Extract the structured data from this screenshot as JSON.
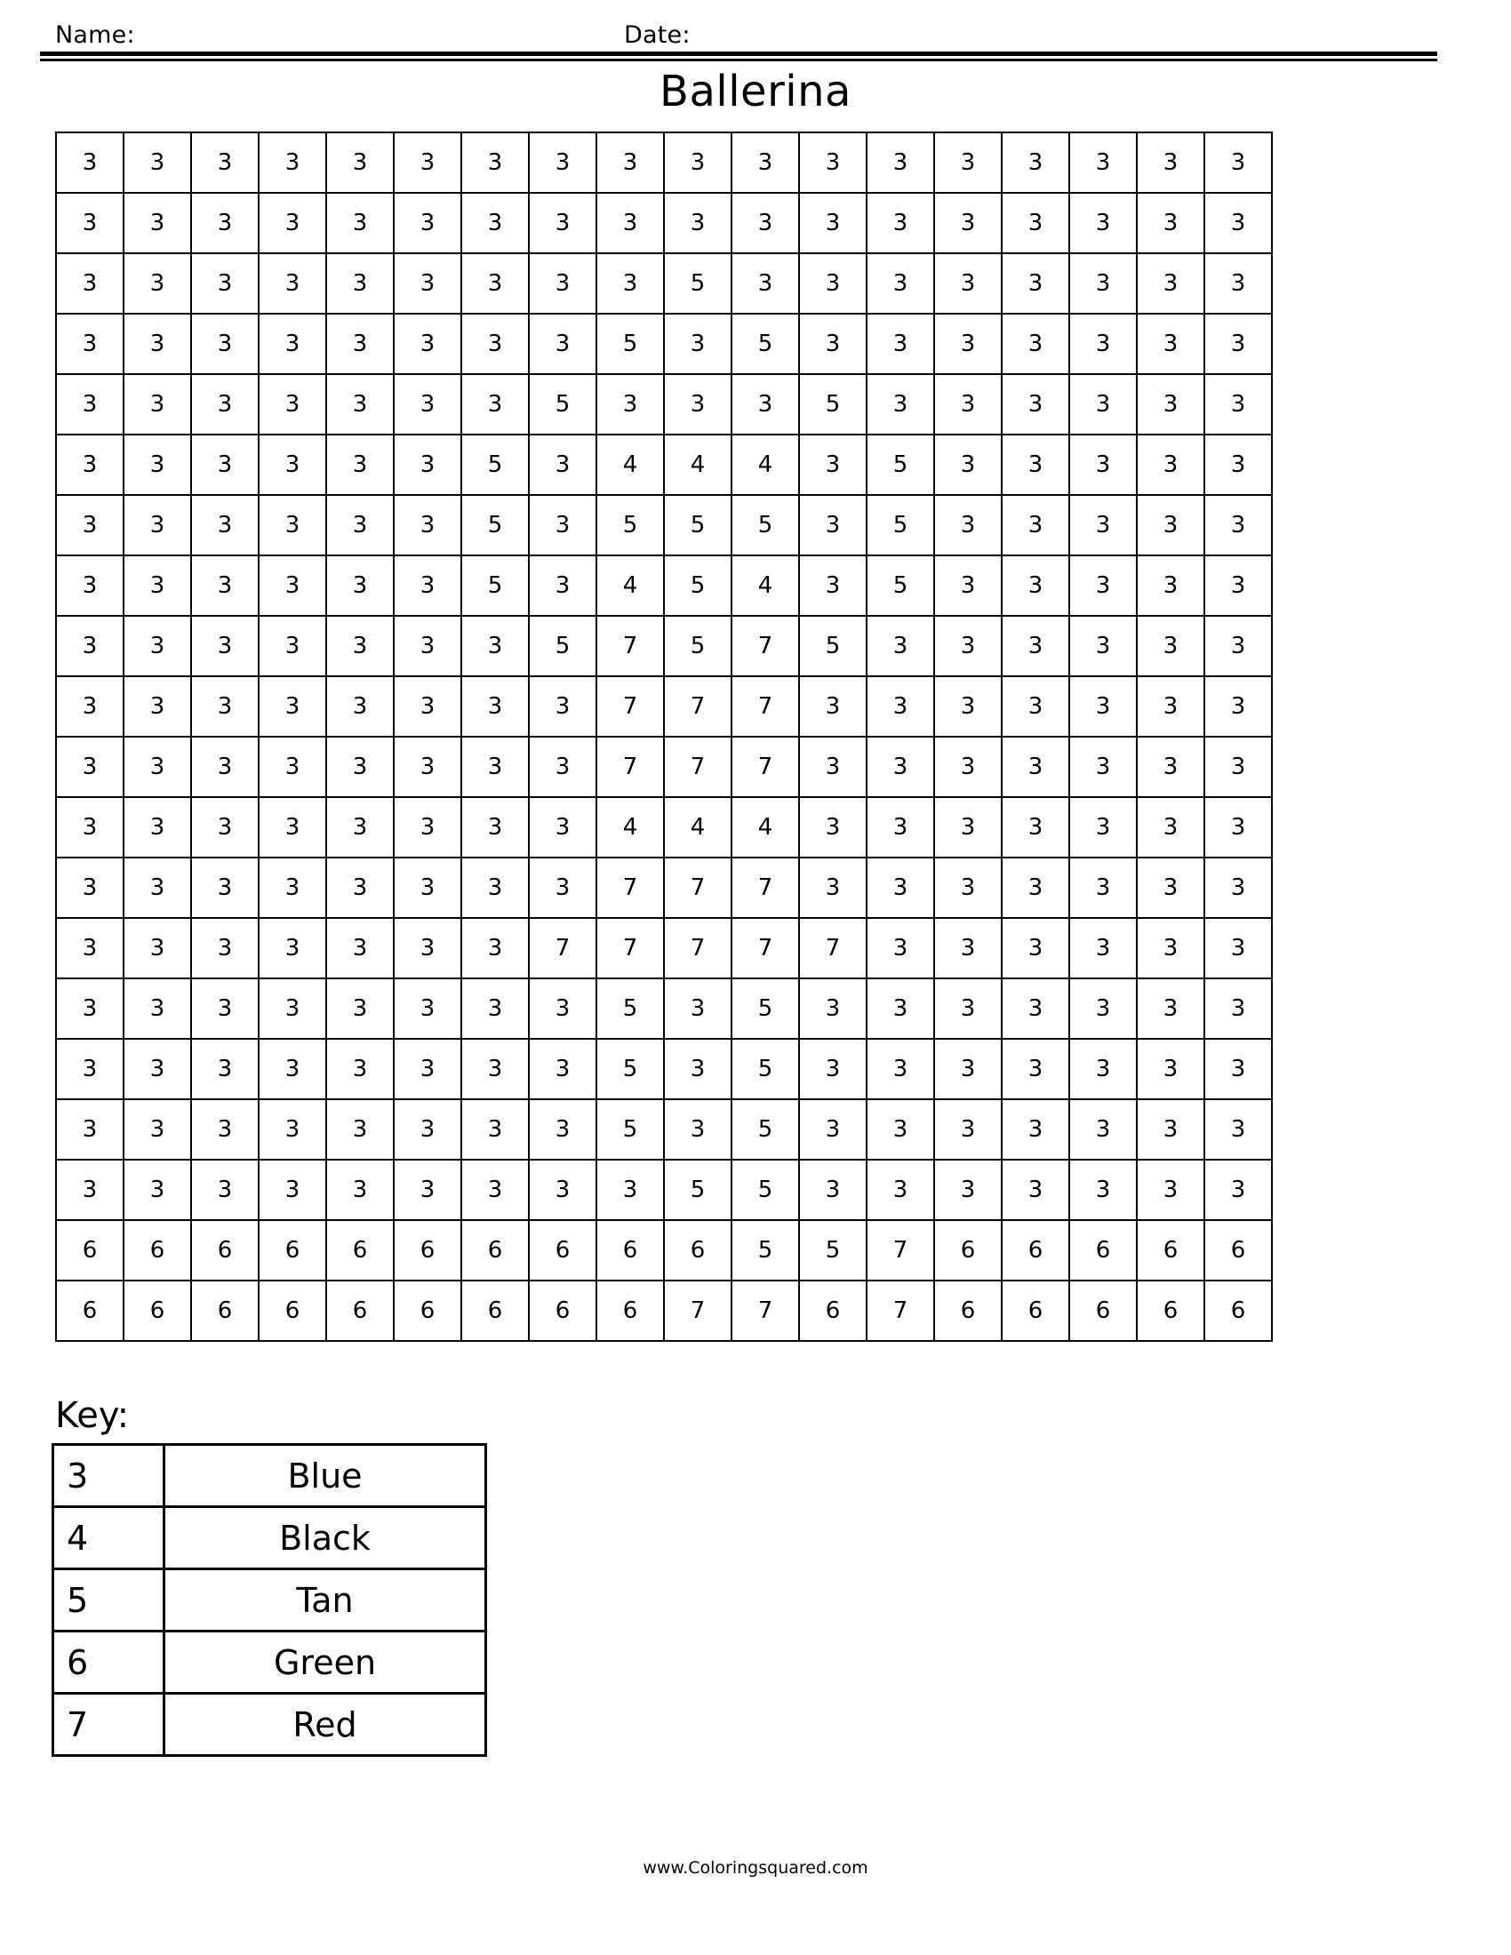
{
  "header": {
    "name_label": "Name:",
    "date_label": "Date:"
  },
  "title": "Ballerina",
  "key": {
    "heading": "Key:",
    "rows": [
      {
        "number": "3",
        "color": "Blue"
      },
      {
        "number": "4",
        "color": "Black"
      },
      {
        "number": "5",
        "color": "Tan"
      },
      {
        "number": "6",
        "color": "Green"
      },
      {
        "number": "7",
        "color": "Red"
      }
    ]
  },
  "footer": "www.Coloringsquared.com",
  "chart_data": {
    "type": "table",
    "title": "Ballerina",
    "rows": 20,
    "columns": 18,
    "legend": [
      {
        "value": "3",
        "label": "Blue"
      },
      {
        "value": "4",
        "label": "Black"
      },
      {
        "value": "5",
        "label": "Tan"
      },
      {
        "value": "6",
        "label": "Green"
      },
      {
        "value": "7",
        "label": "Red"
      }
    ],
    "grid": [
      [
        "3",
        "3",
        "3",
        "3",
        "3",
        "3",
        "3",
        "3",
        "3",
        "3",
        "3",
        "3",
        "3",
        "3",
        "3",
        "3",
        "3",
        "3"
      ],
      [
        "3",
        "3",
        "3",
        "3",
        "3",
        "3",
        "3",
        "3",
        "3",
        "3",
        "3",
        "3",
        "3",
        "3",
        "3",
        "3",
        "3",
        "3"
      ],
      [
        "3",
        "3",
        "3",
        "3",
        "3",
        "3",
        "3",
        "3",
        "3",
        "5",
        "3",
        "3",
        "3",
        "3",
        "3",
        "3",
        "3",
        "3"
      ],
      [
        "3",
        "3",
        "3",
        "3",
        "3",
        "3",
        "3",
        "3",
        "5",
        "3",
        "5",
        "3",
        "3",
        "3",
        "3",
        "3",
        "3",
        "3"
      ],
      [
        "3",
        "3",
        "3",
        "3",
        "3",
        "3",
        "3",
        "5",
        "3",
        "3",
        "3",
        "5",
        "3",
        "3",
        "3",
        "3",
        "3",
        "3"
      ],
      [
        "3",
        "3",
        "3",
        "3",
        "3",
        "3",
        "5",
        "3",
        "4",
        "4",
        "4",
        "3",
        "5",
        "3",
        "3",
        "3",
        "3",
        "3"
      ],
      [
        "3",
        "3",
        "3",
        "3",
        "3",
        "3",
        "5",
        "3",
        "5",
        "5",
        "5",
        "3",
        "5",
        "3",
        "3",
        "3",
        "3",
        "3"
      ],
      [
        "3",
        "3",
        "3",
        "3",
        "3",
        "3",
        "5",
        "3",
        "4",
        "5",
        "4",
        "3",
        "5",
        "3",
        "3",
        "3",
        "3",
        "3"
      ],
      [
        "3",
        "3",
        "3",
        "3",
        "3",
        "3",
        "3",
        "5",
        "7",
        "5",
        "7",
        "5",
        "3",
        "3",
        "3",
        "3",
        "3",
        "3"
      ],
      [
        "3",
        "3",
        "3",
        "3",
        "3",
        "3",
        "3",
        "3",
        "7",
        "7",
        "7",
        "3",
        "3",
        "3",
        "3",
        "3",
        "3",
        "3"
      ],
      [
        "3",
        "3",
        "3",
        "3",
        "3",
        "3",
        "3",
        "3",
        "7",
        "7",
        "7",
        "3",
        "3",
        "3",
        "3",
        "3",
        "3",
        "3"
      ],
      [
        "3",
        "3",
        "3",
        "3",
        "3",
        "3",
        "3",
        "3",
        "4",
        "4",
        "4",
        "3",
        "3",
        "3",
        "3",
        "3",
        "3",
        "3"
      ],
      [
        "3",
        "3",
        "3",
        "3",
        "3",
        "3",
        "3",
        "3",
        "7",
        "7",
        "7",
        "3",
        "3",
        "3",
        "3",
        "3",
        "3",
        "3"
      ],
      [
        "3",
        "3",
        "3",
        "3",
        "3",
        "3",
        "3",
        "7",
        "7",
        "7",
        "7",
        "7",
        "3",
        "3",
        "3",
        "3",
        "3",
        "3"
      ],
      [
        "3",
        "3",
        "3",
        "3",
        "3",
        "3",
        "3",
        "3",
        "5",
        "3",
        "5",
        "3",
        "3",
        "3",
        "3",
        "3",
        "3",
        "3"
      ],
      [
        "3",
        "3",
        "3",
        "3",
        "3",
        "3",
        "3",
        "3",
        "5",
        "3",
        "5",
        "3",
        "3",
        "3",
        "3",
        "3",
        "3",
        "3"
      ],
      [
        "3",
        "3",
        "3",
        "3",
        "3",
        "3",
        "3",
        "3",
        "5",
        "3",
        "5",
        "3",
        "3",
        "3",
        "3",
        "3",
        "3",
        "3"
      ],
      [
        "3",
        "3",
        "3",
        "3",
        "3",
        "3",
        "3",
        "3",
        "3",
        "5",
        "5",
        "3",
        "3",
        "3",
        "3",
        "3",
        "3",
        "3"
      ],
      [
        "6",
        "6",
        "6",
        "6",
        "6",
        "6",
        "6",
        "6",
        "6",
        "6",
        "5",
        "5",
        "7",
        "6",
        "6",
        "6",
        "6",
        "6"
      ],
      [
        "6",
        "6",
        "6",
        "6",
        "6",
        "6",
        "6",
        "6",
        "6",
        "7",
        "7",
        "6",
        "7",
        "6",
        "6",
        "6",
        "6",
        "6"
      ]
    ]
  }
}
